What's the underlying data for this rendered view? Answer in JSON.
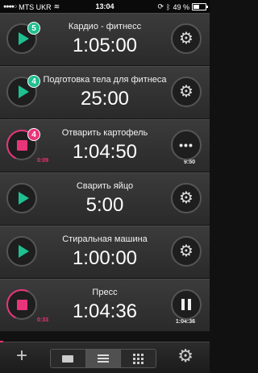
{
  "status": {
    "carrier": "MTS UKR",
    "time": "13:04",
    "battery": "49 %"
  },
  "timers": [
    {
      "title": "Кардио - фитнесс",
      "time": "1:05:00",
      "state": "idle",
      "badge": "5",
      "badge_color": "#1fbf8f",
      "action": "settings"
    },
    {
      "title": "Подготовка тела для фитнеса",
      "time": "25:00",
      "state": "idle",
      "badge": "4",
      "badge_color": "#1fbf8f",
      "action": "settings"
    },
    {
      "title": "Отварить картофель",
      "time": "1:04:50",
      "state": "running",
      "badge": "4",
      "badge_color": "#e8357a",
      "elapsed": "0:09",
      "remaining": "9:50",
      "action": "more"
    },
    {
      "title": "Сварить яйцо",
      "time": "5:00",
      "state": "idle",
      "action": "settings"
    },
    {
      "title": "Стиральная машина",
      "time": "1:00:00",
      "state": "idle",
      "action": "settings"
    },
    {
      "title": "Пресс",
      "time": "1:04:36",
      "state": "running",
      "elapsed": "0:33",
      "remaining": "1:04:36",
      "action": "pause"
    }
  ],
  "toolbar": {
    "add_icon": "plus-icon",
    "views": [
      "card-view-icon",
      "list-view-icon",
      "grid-view-icon"
    ],
    "active_view": "list-view-icon",
    "settings_icon": "gear-icon"
  },
  "colors": {
    "accent_green": "#1fbf8f",
    "accent_pink": "#e8357a"
  }
}
